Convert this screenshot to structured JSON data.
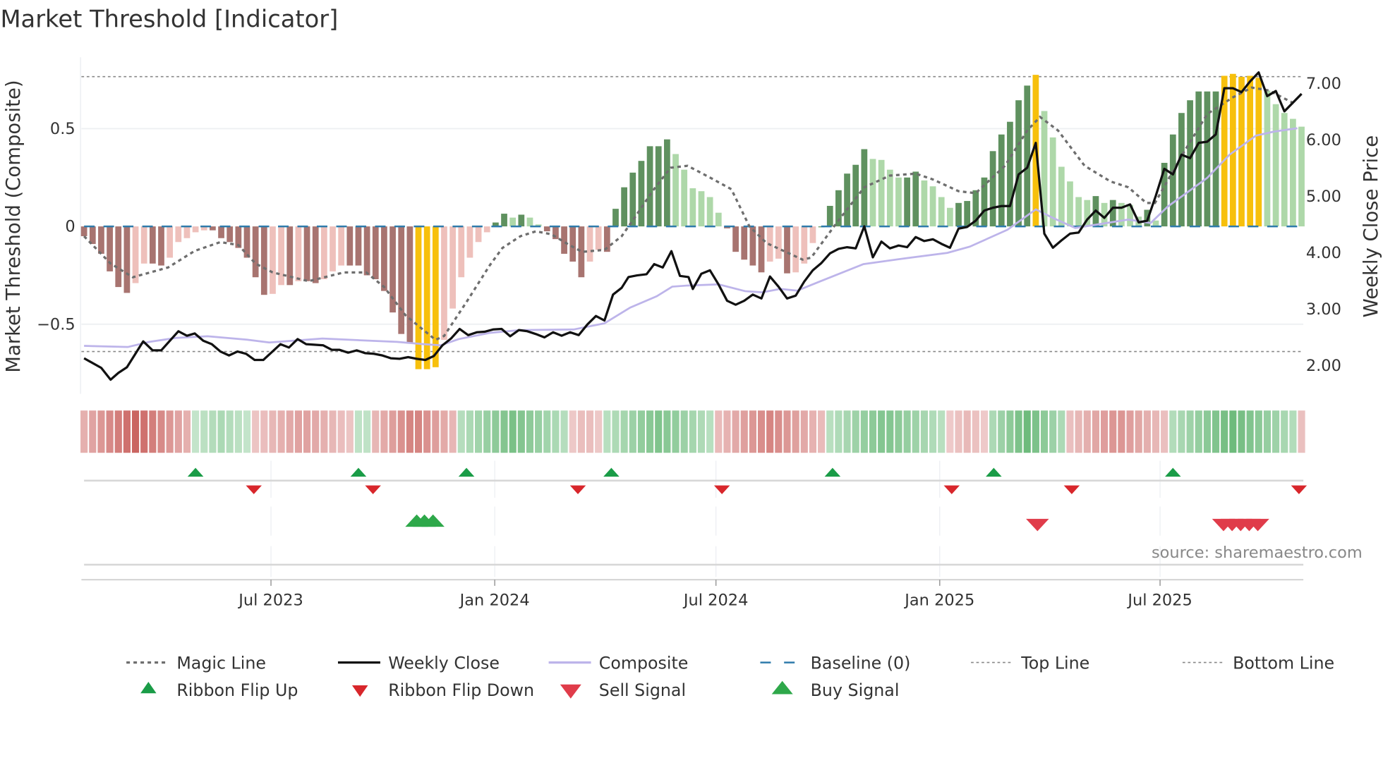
{
  "chart_data": {
    "type": "bar",
    "title": "Market Threshold [Indicator]",
    "ylabel_left": "Market Threshold (Composite)",
    "ylabel_right": "Weekly Close Price",
    "ylim_left": [
      -0.86,
      0.86
    ],
    "ylim_right": [
      1.5,
      7.5
    ],
    "left_ticks": [
      {
        "v": 0.5,
        "label": "0.5"
      },
      {
        "v": 0,
        "label": "0"
      },
      {
        "v": -0.5,
        "label": "−0.5"
      }
    ],
    "right_ticks": [
      {
        "v": 7,
        "label": "7.00"
      },
      {
        "v": 6,
        "label": "6.00"
      },
      {
        "v": 5,
        "label": "5.00"
      },
      {
        "v": 4,
        "label": "4.00"
      },
      {
        "v": 3,
        "label": "3.00"
      },
      {
        "v": 2,
        "label": "2.00"
      }
    ],
    "x_ticks": [
      {
        "week": 22.8,
        "label": "Jul 2023"
      },
      {
        "week": 48.9,
        "label": "Jan 2024"
      },
      {
        "week": 74.7,
        "label": "Jul 2024"
      },
      {
        "week": 100.8,
        "label": "Jan 2025"
      },
      {
        "week": 126.5,
        "label": "Jul 2025"
      }
    ],
    "n_weeks": 143,
    "top_line": 0.766,
    "bottom_line": -0.64,
    "baseline": 0,
    "grid": true,
    "composite_bars": [
      -0.05,
      -0.09,
      -0.14,
      -0.23,
      -0.31,
      -0.34,
      -0.29,
      -0.19,
      -0.19,
      -0.2,
      -0.16,
      -0.08,
      -0.06,
      -0.03,
      -0.02,
      -0.02,
      -0.06,
      -0.08,
      -0.11,
      -0.16,
      -0.26,
      -0.35,
      -0.345,
      -0.3,
      -0.3,
      -0.28,
      -0.28,
      -0.29,
      -0.27,
      -0.23,
      -0.2,
      -0.2,
      -0.2,
      -0.25,
      -0.27,
      -0.33,
      -0.44,
      -0.55,
      -0.6,
      -0.73,
      -0.73,
      -0.72,
      -0.58,
      -0.42,
      -0.26,
      -0.16,
      -0.08,
      -0.03,
      0.02,
      0.065,
      0.045,
      0.06,
      0.045,
      0.01,
      -0.025,
      -0.065,
      -0.14,
      -0.18,
      -0.26,
      -0.18,
      -0.12,
      -0.13,
      0.09,
      0.2,
      0.275,
      0.335,
      0.41,
      0.41,
      0.445,
      0.37,
      0.29,
      0.195,
      0.18,
      0.15,
      0.07,
      -0.01,
      -0.13,
      -0.17,
      -0.2,
      -0.235,
      -0.18,
      -0.165,
      -0.24,
      -0.235,
      -0.19,
      -0.085,
      0.0,
      0.105,
      0.185,
      0.27,
      0.315,
      0.395,
      0.345,
      0.34,
      0.29,
      0.25,
      0.25,
      0.28,
      0.235,
      0.205,
      0.15,
      0.095,
      0.12,
      0.13,
      0.185,
      0.25,
      0.385,
      0.47,
      0.535,
      0.645,
      0.72,
      0.775,
      0.59,
      0.455,
      0.305,
      0.23,
      0.15,
      0.135,
      0.155,
      0.12,
      0.135,
      0.12,
      0.11,
      0.05,
      0.085,
      0.03,
      0.325,
      0.47,
      0.58,
      0.645,
      0.69,
      0.69,
      0.69,
      0.77,
      0.78,
      0.765,
      0.77,
      0.76,
      0.695,
      0.625,
      0.58,
      0.55,
      0.51
    ],
    "magic_line": [
      [
        1,
        -0.05
      ],
      [
        4.1,
        -0.19
      ],
      [
        6.7,
        -0.26
      ],
      [
        10.8,
        -0.21
      ],
      [
        13.9,
        -0.125
      ],
      [
        16.9,
        -0.08
      ],
      [
        19,
        -0.095
      ],
      [
        21,
        -0.19
      ],
      [
        23,
        -0.235
      ],
      [
        27.2,
        -0.28
      ],
      [
        31.3,
        -0.235
      ],
      [
        33.9,
        -0.235
      ],
      [
        36,
        -0.31
      ],
      [
        38.5,
        -0.455
      ],
      [
        40.6,
        -0.53
      ],
      [
        42,
        -0.58
      ],
      [
        43,
        -0.56
      ],
      [
        45.7,
        -0.38
      ],
      [
        48.3,
        -0.2
      ],
      [
        49.8,
        -0.11
      ],
      [
        51.9,
        -0.05
      ],
      [
        53.7,
        -0.025
      ],
      [
        55.5,
        -0.04
      ],
      [
        57.6,
        -0.095
      ],
      [
        59.1,
        -0.13
      ],
      [
        61.7,
        -0.12
      ],
      [
        63.7,
        -0.05
      ],
      [
        65.3,
        0.05
      ],
      [
        67.3,
        0.18
      ],
      [
        69.4,
        0.3
      ],
      [
        71.4,
        0.31
      ],
      [
        74,
        0.25
      ],
      [
        76.5,
        0.19
      ],
      [
        78.6,
        0
      ],
      [
        80.6,
        -0.085
      ],
      [
        84.8,
        -0.17
      ],
      [
        85.8,
        -0.16
      ],
      [
        88.9,
        0.025
      ],
      [
        92,
        0.2
      ],
      [
        95,
        0.26
      ],
      [
        98,
        0.27
      ],
      [
        100,
        0.24
      ],
      [
        103,
        0.18
      ],
      [
        105,
        0.17
      ],
      [
        108.4,
        0.31
      ],
      [
        111,
        0.49
      ],
      [
        112.5,
        0.56
      ],
      [
        114.6,
        0.49
      ],
      [
        117.7,
        0.31
      ],
      [
        120.7,
        0.23
      ],
      [
        122.8,
        0.2
      ],
      [
        124.9,
        0.12
      ],
      [
        125.9,
        0.12
      ],
      [
        129,
        0.36
      ],
      [
        132,
        0.575
      ],
      [
        135,
        0.66
      ],
      [
        137.2,
        0.71
      ],
      [
        139.2,
        0.695
      ],
      [
        142.3,
        0.625
      ]
    ],
    "weekly_close": [
      [
        1,
        2.13
      ],
      [
        3,
        1.96
      ],
      [
        4.1,
        1.75
      ],
      [
        5,
        1.87
      ],
      [
        6,
        1.97
      ],
      [
        7.9,
        2.43
      ],
      [
        9,
        2.27
      ],
      [
        10,
        2.27
      ],
      [
        12,
        2.61
      ],
      [
        13,
        2.53
      ],
      [
        13.9,
        2.57
      ],
      [
        14.9,
        2.44
      ],
      [
        15.9,
        2.38
      ],
      [
        16.9,
        2.25
      ],
      [
        17.9,
        2.18
      ],
      [
        18.9,
        2.25
      ],
      [
        19.9,
        2.21
      ],
      [
        20.9,
        2.1
      ],
      [
        21.9,
        2.1
      ],
      [
        23.9,
        2.38
      ],
      [
        24.9,
        2.32
      ],
      [
        25.9,
        2.47
      ],
      [
        26.9,
        2.38
      ],
      [
        28.9,
        2.36
      ],
      [
        29.9,
        2.28
      ],
      [
        30.8,
        2.28
      ],
      [
        31.8,
        2.23
      ],
      [
        32.8,
        2.27
      ],
      [
        33.8,
        2.22
      ],
      [
        34.8,
        2.21
      ],
      [
        35.8,
        2.18
      ],
      [
        36.8,
        2.13
      ],
      [
        37.8,
        2.12
      ],
      [
        38.8,
        2.15
      ],
      [
        39.8,
        2.12
      ],
      [
        40.8,
        2.1
      ],
      [
        41.8,
        2.17
      ],
      [
        42.8,
        2.36
      ],
      [
        43.8,
        2.48
      ],
      [
        44.8,
        2.65
      ],
      [
        45.8,
        2.54
      ],
      [
        46.8,
        2.59
      ],
      [
        47.7,
        2.6
      ],
      [
        48.7,
        2.64
      ],
      [
        49.7,
        2.65
      ],
      [
        50.7,
        2.52
      ],
      [
        51.7,
        2.63
      ],
      [
        52.7,
        2.61
      ],
      [
        53.7,
        2.56
      ],
      [
        54.7,
        2.5
      ],
      [
        55.7,
        2.59
      ],
      [
        56.7,
        2.53
      ],
      [
        57.7,
        2.59
      ],
      [
        58.7,
        2.54
      ],
      [
        59.7,
        2.73
      ],
      [
        60.7,
        2.88
      ],
      [
        61.7,
        2.8
      ],
      [
        62.7,
        3.26
      ],
      [
        63.7,
        3.38
      ],
      [
        64.5,
        3.57
      ],
      [
        65.5,
        3.6
      ],
      [
        66.6,
        3.62
      ],
      [
        67.5,
        3.8
      ],
      [
        68.5,
        3.74
      ],
      [
        69.5,
        4.03
      ],
      [
        70.5,
        3.59
      ],
      [
        71.5,
        3.57
      ],
      [
        72,
        3.36
      ],
      [
        73,
        3.63
      ],
      [
        74,
        3.69
      ],
      [
        75,
        3.44
      ],
      [
        76,
        3.15
      ],
      [
        77,
        3.08
      ],
      [
        78,
        3.15
      ],
      [
        79,
        3.26
      ],
      [
        80,
        3.19
      ],
      [
        81,
        3.58
      ],
      [
        82,
        3.4
      ],
      [
        83,
        3.19
      ],
      [
        84,
        3.24
      ],
      [
        85,
        3.49
      ],
      [
        86,
        3.69
      ],
      [
        87,
        3.82
      ],
      [
        88,
        3.99
      ],
      [
        89,
        4.07
      ],
      [
        90,
        4.1
      ],
      [
        91,
        4.08
      ],
      [
        92,
        4.47
      ],
      [
        93,
        3.92
      ],
      [
        94,
        4.2
      ],
      [
        95,
        4.08
      ],
      [
        96,
        4.13
      ],
      [
        97,
        4.1
      ],
      [
        98,
        4.28
      ],
      [
        99,
        4.21
      ],
      [
        100,
        4.24
      ],
      [
        101,
        4.16
      ],
      [
        102,
        4.09
      ],
      [
        103,
        4.43
      ],
      [
        104,
        4.46
      ],
      [
        105,
        4.57
      ],
      [
        106,
        4.75
      ],
      [
        107,
        4.8
      ],
      [
        108,
        4.83
      ],
      [
        109,
        4.83
      ],
      [
        110,
        5.39
      ],
      [
        111,
        5.51
      ],
      [
        112,
        5.95
      ],
      [
        113,
        4.34
      ],
      [
        114,
        4.09
      ],
      [
        115,
        4.22
      ],
      [
        116,
        4.34
      ],
      [
        117,
        4.36
      ],
      [
        118,
        4.59
      ],
      [
        119,
        4.75
      ],
      [
        120,
        4.62
      ],
      [
        121,
        4.8
      ],
      [
        122,
        4.8
      ],
      [
        123,
        4.86
      ],
      [
        124,
        4.54
      ],
      [
        125,
        4.57
      ],
      [
        126,
        5.01
      ],
      [
        127,
        5.49
      ],
      [
        128,
        5.39
      ],
      [
        129,
        5.74
      ],
      [
        130,
        5.68
      ],
      [
        131,
        5.95
      ],
      [
        132,
        5.97
      ],
      [
        133,
        6.1
      ],
      [
        134,
        6.92
      ],
      [
        135,
        6.92
      ],
      [
        136,
        6.85
      ],
      [
        137,
        7.04
      ],
      [
        138,
        7.2
      ],
      [
        139,
        6.78
      ],
      [
        140,
        6.87
      ],
      [
        141,
        6.51
      ],
      [
        143,
        6.82
      ]
    ],
    "composite_line": [
      [
        1,
        2.35
      ],
      [
        6.1,
        2.33
      ],
      [
        8.6,
        2.42
      ],
      [
        11.7,
        2.49
      ],
      [
        15.4,
        2.52
      ],
      [
        20,
        2.46
      ],
      [
        22.6,
        2.41
      ],
      [
        28.8,
        2.48
      ],
      [
        37.5,
        2.42
      ],
      [
        40.6,
        2.38
      ],
      [
        42.6,
        2.36
      ],
      [
        44.7,
        2.47
      ],
      [
        48.3,
        2.58
      ],
      [
        51.9,
        2.63
      ],
      [
        58.1,
        2.64
      ],
      [
        61.7,
        2.75
      ],
      [
        64.7,
        3.03
      ],
      [
        67.8,
        3.23
      ],
      [
        69.6,
        3.4
      ],
      [
        71.4,
        3.42
      ],
      [
        75,
        3.44
      ],
      [
        78.1,
        3.32
      ],
      [
        80.1,
        3.3
      ],
      [
        82.2,
        3.36
      ],
      [
        84.2,
        3.33
      ],
      [
        86.8,
        3.49
      ],
      [
        91.9,
        3.8
      ],
      [
        97.1,
        3.91
      ],
      [
        101.7,
        4.0
      ],
      [
        104.3,
        4.11
      ],
      [
        108.7,
        4.41
      ],
      [
        112,
        4.77
      ],
      [
        114,
        4.62
      ],
      [
        116.6,
        4.44
      ],
      [
        122.8,
        4.59
      ],
      [
        125.4,
        4.53
      ],
      [
        127.4,
        4.82
      ],
      [
        132,
        5.33
      ],
      [
        134.6,
        5.74
      ],
      [
        137.7,
        6.08
      ],
      [
        139.8,
        6.15
      ],
      [
        142.5,
        6.21
      ]
    ],
    "ribbon_segments": [
      {
        "from": 1,
        "to": 13,
        "dir": "down",
        "peak": 0.9
      },
      {
        "from": 14,
        "to": 20,
        "dir": "up",
        "peak": 0.35
      },
      {
        "from": 21,
        "to": 32,
        "dir": "down",
        "peak": 0.45
      },
      {
        "from": 33,
        "to": 34,
        "dir": "up",
        "peak": 0.25
      },
      {
        "from": 35,
        "to": 44,
        "dir": "down",
        "peak": 0.7
      },
      {
        "from": 45,
        "to": 57,
        "dir": "up",
        "peak": 0.75
      },
      {
        "from": 58,
        "to": 61,
        "dir": "down",
        "peak": 0.25
      },
      {
        "from": 62,
        "to": 74,
        "dir": "up",
        "peak": 0.7
      },
      {
        "from": 75,
        "to": 87,
        "dir": "down",
        "peak": 0.65
      },
      {
        "from": 88,
        "to": 101,
        "dir": "up",
        "peak": 0.7
      },
      {
        "from": 102,
        "to": 106,
        "dir": "down",
        "peak": 0.25
      },
      {
        "from": 107,
        "to": 115,
        "dir": "up",
        "peak": 0.85
      },
      {
        "from": 116,
        "to": 127,
        "dir": "down",
        "peak": 0.55
      },
      {
        "from": 128,
        "to": 142,
        "dir": "up",
        "peak": 0.85
      },
      {
        "from": 143,
        "to": 143,
        "dir": "down",
        "peak": 0.2
      }
    ],
    "ribbon_flip_up": [
      14,
      33,
      45.6,
      62.5,
      88.3,
      107.1,
      128
    ],
    "ribbon_flip_down": [
      20.8,
      34.7,
      58.6,
      75.4,
      102.2,
      116.2,
      142.7
    ],
    "buy_signals": [
      39.8,
      40.7,
      41.7
    ],
    "sell_signals": [
      112.2,
      133.9,
      134.9,
      135.9,
      136.9,
      137.9
    ],
    "source": "source: sharemaestro.com",
    "legend": [
      {
        "key": "magic",
        "label": "Magic Line"
      },
      {
        "key": "close",
        "label": "Weekly Close"
      },
      {
        "key": "composite",
        "label": "Composite"
      },
      {
        "key": "baseline",
        "label": "Baseline (0)"
      },
      {
        "key": "top",
        "label": "Top Line"
      },
      {
        "key": "bottom",
        "label": "Bottom Line"
      },
      {
        "key": "flipup",
        "label": "Ribbon Flip Up"
      },
      {
        "key": "flipdown",
        "label": "Ribbon Flip Down"
      },
      {
        "key": "sell",
        "label": "Sell Signal"
      },
      {
        "key": "buy",
        "label": "Buy Signal"
      }
    ],
    "colors": {
      "neg_dark": "#a87470",
      "neg_light": "#eec0bb",
      "pos_dark": "#5f915f",
      "pos_light": "#aed8a9",
      "extreme": "#f7c00c",
      "magic": "#6e6e6e",
      "close": "#111111",
      "composite": "#bdb4ea",
      "baseline": "#2e7bab",
      "threshold": "#888888",
      "flip_up": "#1a9c47",
      "flip_down": "#d8262b",
      "buy": "#2ea84a",
      "sell": "#e03c4a"
    }
  }
}
